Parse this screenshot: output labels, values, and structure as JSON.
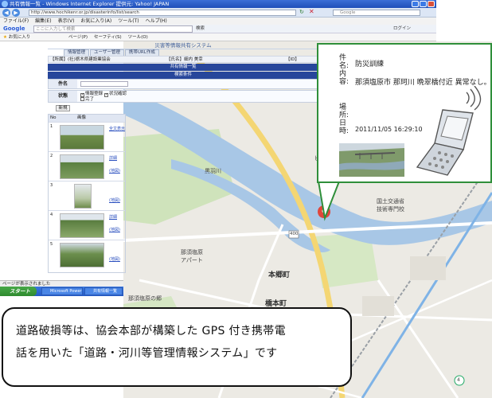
{
  "browser": {
    "title": "共有情報一覧 - Windows Internet Explorer 提供元: Yahoo! JAPAN",
    "url": "http://www.hochikenr.or.jp/disasterinfo/list/search",
    "site_search_placeholder": "Google",
    "menu": [
      "ファイル(F)",
      "編集(E)",
      "表示(V)",
      "お気に入り(A)",
      "ツール(T)",
      "ヘルプ(H)"
    ],
    "google_toolbar": {
      "logo": "Google",
      "placeholder": "ここに入力して検索",
      "search_label": "検索",
      "login_label": "ログイン"
    },
    "favorites_label": "お気に入り",
    "tools": [
      "ページ(P)",
      "セーフティ(S)",
      "ツール(O)"
    ],
    "status_text": "ページが表示されました"
  },
  "app": {
    "system_title": "災害等情報共有システム",
    "tabs": [
      "情報管理",
      "ユーザー管理",
      "携帯URL作成"
    ],
    "info": {
      "org": "【所属】(社)栃木県建設業協会",
      "user": "【氏名】細内 美幸",
      "id": "【ID】hosouchi"
    },
    "list_title": "共有情報一覧",
    "search_band": "検索条件",
    "search": {
      "name_label": "件名",
      "status_label": "状態",
      "status_options": [
        "情報登録",
        "状況確認",
        "完了"
      ]
    },
    "new_button": "新規",
    "list_columns": [
      "No",
      "画像"
    ],
    "rows": [
      {
        "no": "1",
        "link1": "全文表示"
      },
      {
        "no": "2",
        "link1": "詳細",
        "link2": "(地図)"
      },
      {
        "no": "3",
        "link1": "(地図)"
      },
      {
        "no": "4",
        "link1": "詳細",
        "link2": "(地図)"
      },
      {
        "no": "5",
        "link1": "(地図)"
      }
    ]
  },
  "taskbar": {
    "start_label": "スタート",
    "tasks": [
      "Microsoft PowerPoint...",
      "共有情報一覧"
    ]
  },
  "map": {
    "labels": {
      "place1": "黒羽川",
      "place2": "那須塩原\nアパート",
      "place3": "本郷町",
      "place4": "橋本町",
      "place5": "国土交通省\n技術専門校",
      "place6": "那須塩原の郷",
      "place7": "ピッ",
      "route": "400",
      "shield": "4"
    },
    "colors": {
      "river": "#a9c8e8",
      "road": "#ffffff",
      "major_road": "#f6d77a",
      "green": "#c9e0b4",
      "marker": "#e0473c"
    }
  },
  "popup": {
    "subject_label": "件名:",
    "subject": "防災訓練",
    "content_label": "内容:",
    "content": "那須塩原市 那珂川 晩翠橋付近 異常なし。",
    "location_label": "場所:",
    "datetime_label": "日時:",
    "datetime": "2011/11/05 16:29:10"
  },
  "caption": {
    "line1": "道路破損等は、協会本部が構築した GPS 付き携帯電",
    "line2": "話を用いた「道路・河川等管理情報システム」です"
  }
}
